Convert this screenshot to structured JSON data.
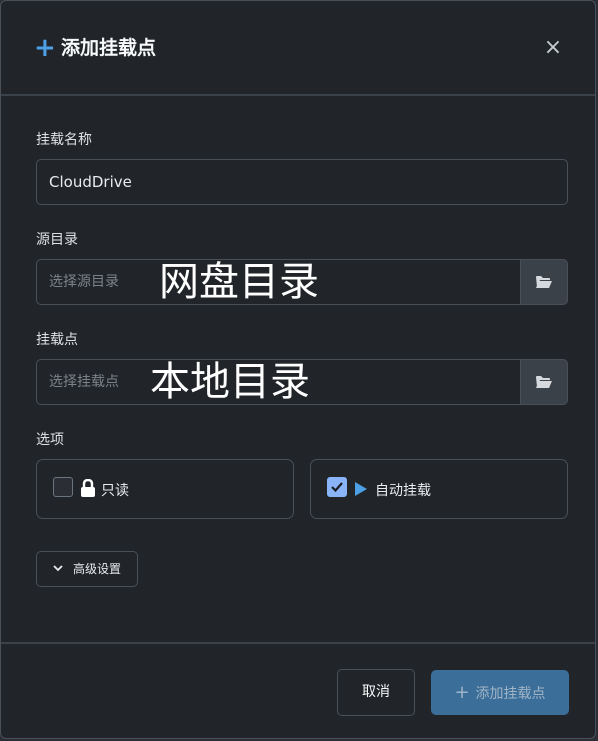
{
  "dialog": {
    "title": "添加挂载点",
    "close_label": "×"
  },
  "form": {
    "mount_name": {
      "label": "挂载名称",
      "value": "CloudDrive"
    },
    "source_dir": {
      "label": "源目录",
      "placeholder": "选择源目录",
      "overlay_text": "网盘目录"
    },
    "mount_point": {
      "label": "挂载点",
      "placeholder": "选择挂载点",
      "overlay_text": "本地目录"
    },
    "options": {
      "label": "选项",
      "read_only": {
        "label": "只读",
        "checked": false
      },
      "auto_mount": {
        "label": "自动挂载",
        "checked": true
      }
    },
    "advanced_label": "高级设置"
  },
  "footer": {
    "cancel_label": "取消",
    "submit_label": "添加挂载点"
  },
  "colors": {
    "accent": "#4d9fe6",
    "background": "#212529",
    "border": "#495057",
    "submit_bg": "#3c6e9a"
  }
}
